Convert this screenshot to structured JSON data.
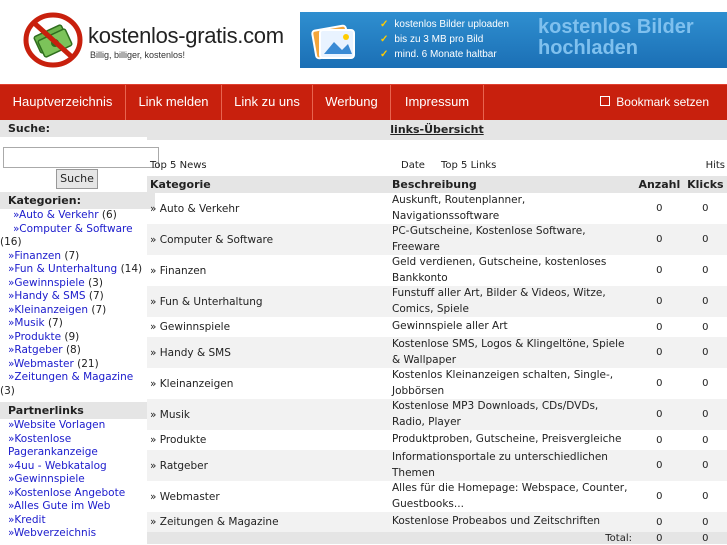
{
  "header": {
    "site_name": "kostenlos-gratis.com",
    "tagline": "Billig, billiger, kostenlos!",
    "banner": {
      "bullets": [
        "kostenlos Bilder uploaden",
        "bis zu 3 MB pro Bild",
        "mind. 6 Monate haltbar"
      ],
      "headline_1": "kostenlos Bilder",
      "headline_2": "hochladen"
    }
  },
  "nav": {
    "items": [
      "Hauptverzeichnis",
      "Link melden",
      "Link zu uns",
      "Werbung",
      "Impressum"
    ],
    "bookmark": "Bookmark setzen"
  },
  "sidebar": {
    "search_label": "Suche:",
    "search_value": "",
    "search_button": "Suche",
    "categories_label": "Kategorien:",
    "categories": [
      {
        "label": "»Auto & Verkehr",
        "count": "(6)"
      },
      {
        "label": "»Computer & Software",
        "count": "(16)"
      },
      {
        "label": "»Finanzen",
        "count": "(7)"
      },
      {
        "label": "»Fun & Unterhaltung",
        "count": "(14)"
      },
      {
        "label": "»Gewinnspiele",
        "count": "(3)"
      },
      {
        "label": "»Handy & SMS",
        "count": "(7)"
      },
      {
        "label": "»Kleinanzeigen",
        "count": "(7)"
      },
      {
        "label": "»Musik",
        "count": "(7)"
      },
      {
        "label": "»Produkte",
        "count": "(9)"
      },
      {
        "label": "»Ratgeber",
        "count": "(8)"
      },
      {
        "label": "»Webmaster",
        "count": "(21)"
      },
      {
        "label": "»Zeitungen & Magazine",
        "count": "(3)"
      }
    ],
    "partner_label": "Partnerlinks",
    "partners": [
      "»Website Vorlagen",
      "»Kostenlose Pagerankanzeige",
      "»4uu - Webkatalog",
      "»Gewinnspiele",
      "»Kostenlose Angebote",
      "»Alles Gute im Web",
      "»Kredit",
      "»Webverzeichnis"
    ]
  },
  "main": {
    "title": "links-Übersicht",
    "sub": {
      "news": "Top 5 News",
      "date": "Date",
      "links": "Top 5 Links",
      "hits": "Hits"
    },
    "columns": {
      "kategorie": "Kategorie",
      "beschreibung": "Beschreibung",
      "anzahl": "Anzahl",
      "klicks": "Klicks"
    },
    "rows": [
      {
        "cat": "» Auto & Verkehr",
        "desc": "Auskunft, Routenplanner, Navigationssoftware",
        "anzahl": "0",
        "klicks": "0"
      },
      {
        "cat": "» Computer & Software",
        "desc": "PC-Gutscheine, Kostenlose Software, Freeware",
        "anzahl": "0",
        "klicks": "0"
      },
      {
        "cat": "» Finanzen",
        "desc": "Geld verdienen, Gutscheine, kostenloses Bankkonto",
        "anzahl": "0",
        "klicks": "0"
      },
      {
        "cat": "» Fun & Unterhaltung",
        "desc": "Funstuff aller Art, Bilder & Videos, Witze, Comics, Spiele",
        "anzahl": "0",
        "klicks": "0"
      },
      {
        "cat": "» Gewinnspiele",
        "desc": "Gewinnspiele aller Art",
        "anzahl": "0",
        "klicks": "0"
      },
      {
        "cat": "» Handy & SMS",
        "desc": "Kostenlose SMS, Logos & Klingeltöne, Spiele & Wallpaper",
        "anzahl": "0",
        "klicks": "0"
      },
      {
        "cat": "» Kleinanzeigen",
        "desc": "Kostenlos Kleinanzeigen schalten, Single-, Jobbörsen",
        "anzahl": "0",
        "klicks": "0"
      },
      {
        "cat": "» Musik",
        "desc": "Kostenlose MP3 Downloads, CDs/DVDs, Radio, Player",
        "anzahl": "0",
        "klicks": "0"
      },
      {
        "cat": "» Produkte",
        "desc": "Produktproben, Gutscheine, Preisvergleiche",
        "anzahl": "0",
        "klicks": "0"
      },
      {
        "cat": "» Ratgeber",
        "desc": "Informationsportale zu unterschiedlichen Themen",
        "anzahl": "0",
        "klicks": "0"
      },
      {
        "cat": "» Webmaster",
        "desc": "Alles für die Homepage: Webspace, Counter, Guestbooks...",
        "anzahl": "0",
        "klicks": "0"
      },
      {
        "cat": "» Zeitungen & Magazine",
        "desc": "Kostenlose Probeabos und Zeitschriften",
        "anzahl": "0",
        "klicks": "0"
      }
    ],
    "total_label": "Total:",
    "total_anzahl": "0",
    "total_klicks": "0"
  },
  "colors": {
    "nav_red": "#c8200d",
    "link_blue": "#1a1acc",
    "header_gray": "#e5e5e5",
    "banner_blue": "#1b6fb5"
  }
}
